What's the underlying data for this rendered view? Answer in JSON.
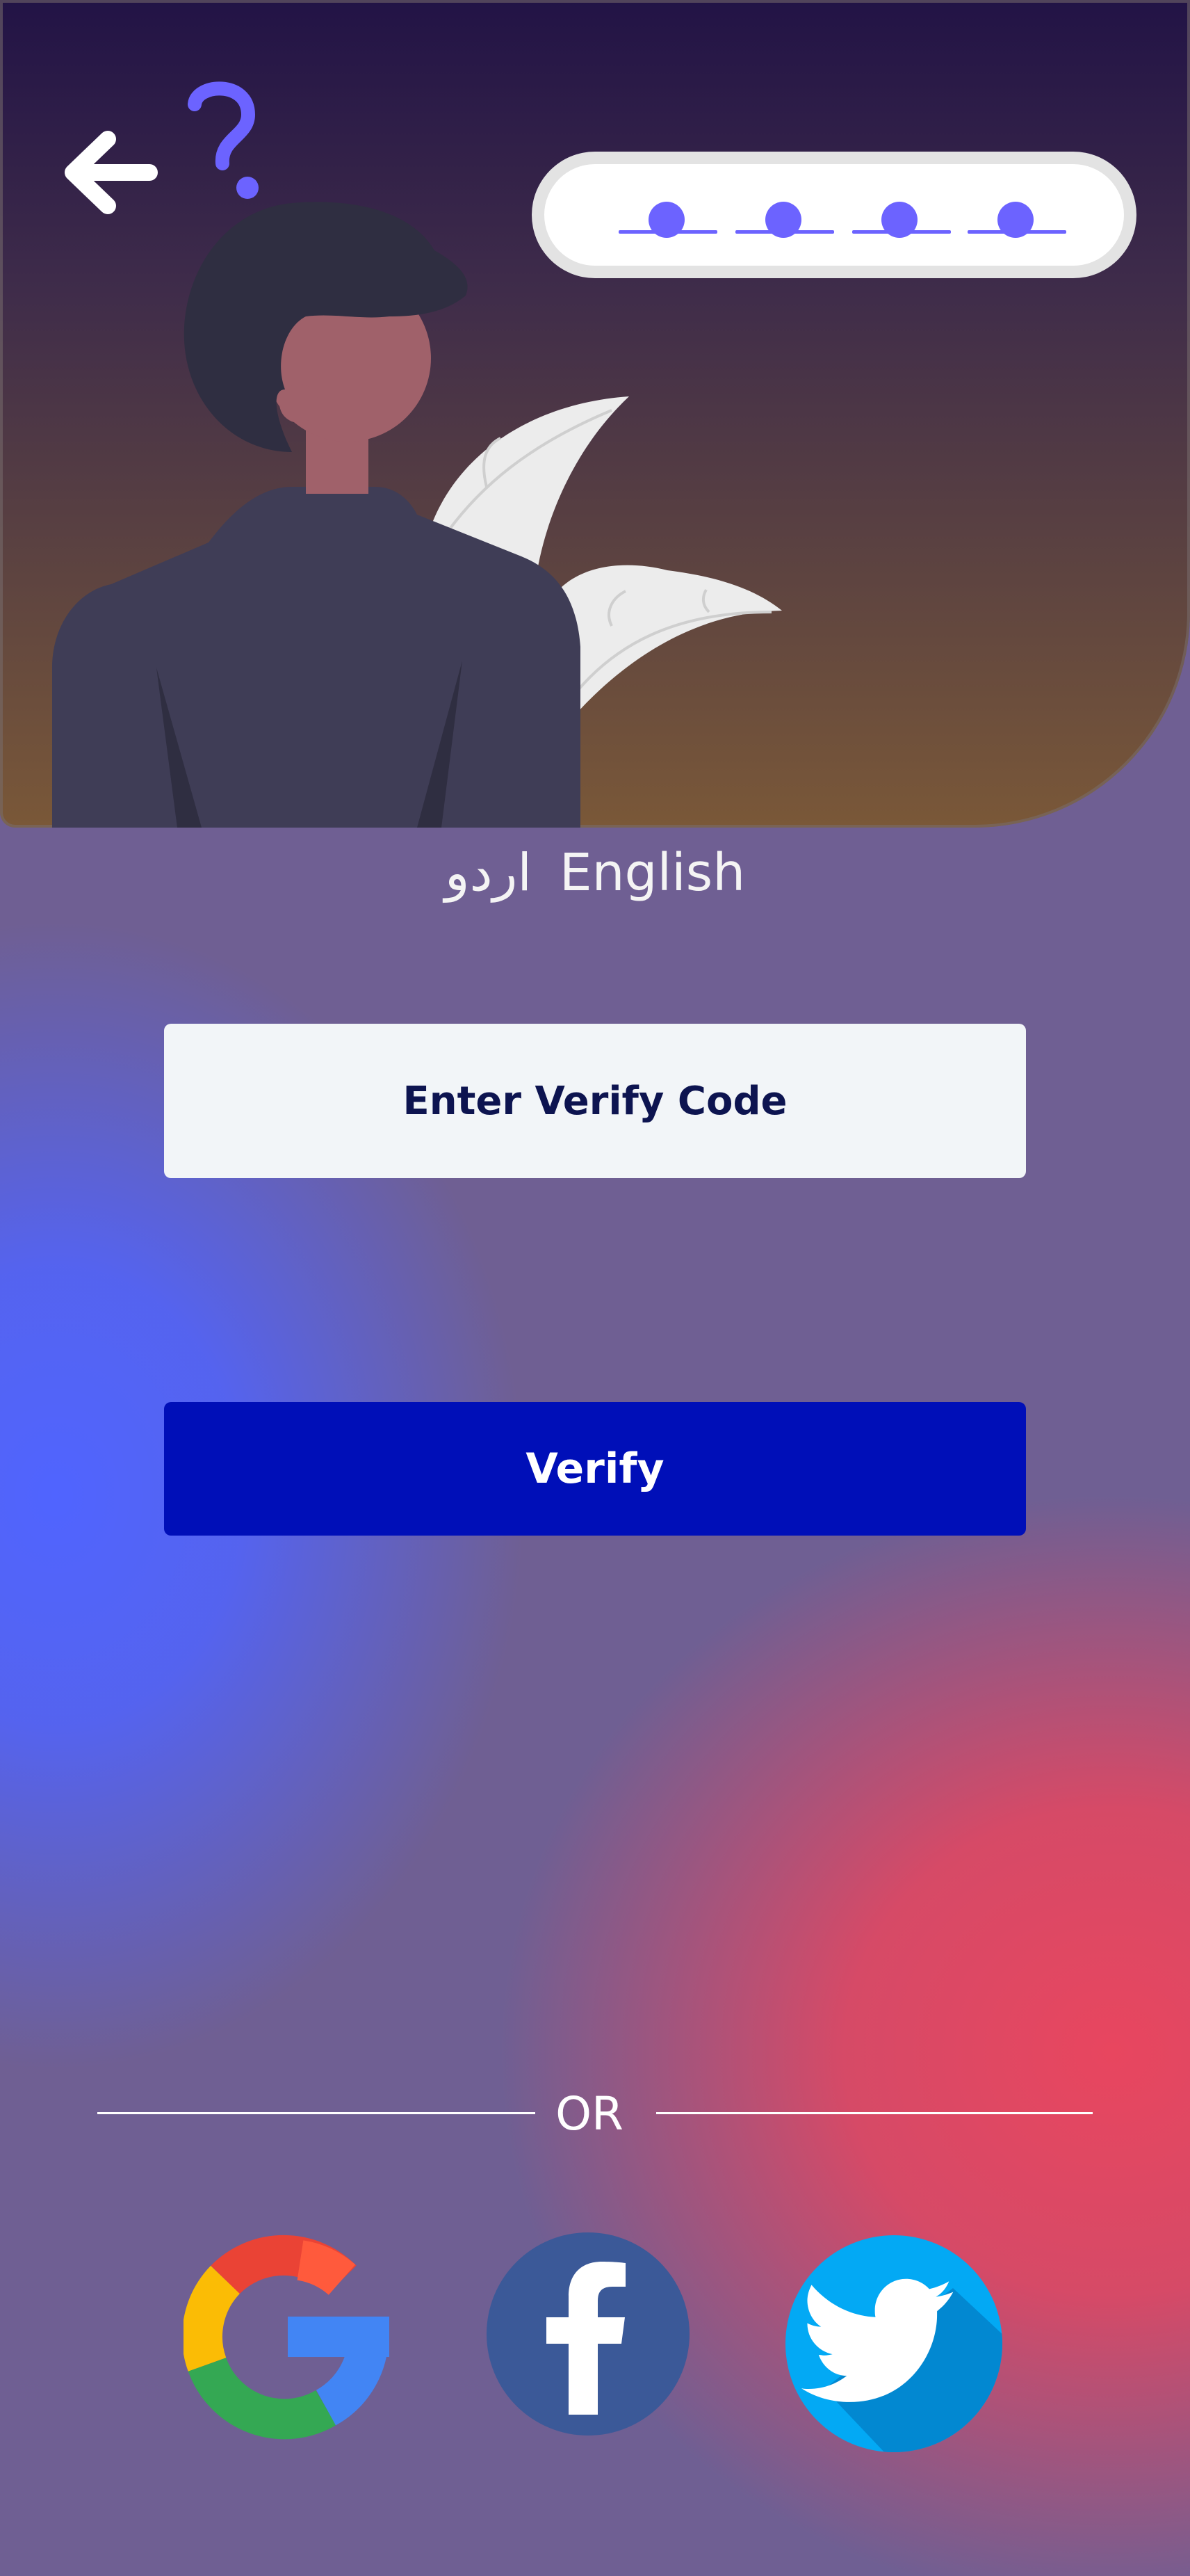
{
  "header": {
    "back_icon": "arrow-left-icon",
    "question_icon": "question-mark-icon",
    "pin_dots": 4
  },
  "language": {
    "urdu_label": "اردو",
    "english_label": "English"
  },
  "form": {
    "code_placeholder": "Enter Verify Code",
    "code_value": "",
    "verify_label": "Verify"
  },
  "divider": {
    "or_label": "OR"
  },
  "social": [
    {
      "name": "google",
      "icon": "google-icon"
    },
    {
      "name": "facebook",
      "icon": "facebook-icon"
    },
    {
      "name": "twitter",
      "icon": "twitter-icon"
    }
  ],
  "colors": {
    "accent": "#6c63ff",
    "verify_button": "#000fb8",
    "input_background": "#f2f5f8",
    "facebook_blue": "#3b5998",
    "twitter_blue": "#03a9f4"
  }
}
